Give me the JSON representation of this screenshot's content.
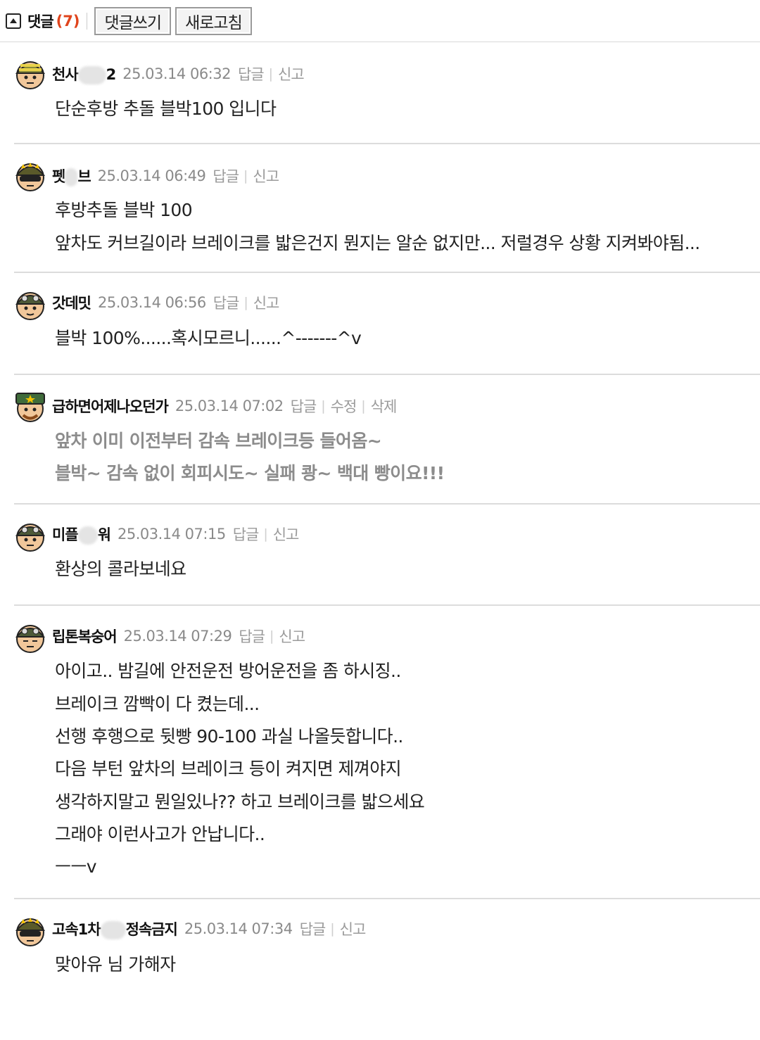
{
  "header": {
    "comment_label": "댓글",
    "comment_count": "(7)",
    "write_button": "댓글쓰기",
    "refresh_button": "새로고침"
  },
  "comments": [
    {
      "author_start": "천사",
      "author_end": "2",
      "date": "25.03.14 06:32",
      "actions": [
        "답글",
        "신고"
      ],
      "lines": [
        "단순후방 추돌 블박100 입니다"
      ]
    },
    {
      "author_start": "펫",
      "author_end": "브",
      "date": "25.03.14 06:49",
      "actions": [
        "답글",
        "신고"
      ],
      "lines": [
        "후방추돌 블박 100",
        "앞차도 커브길이라 브레이크를 밟은건지 뭔지는 알순 없지만... 저럴경우 상황 지켜봐야됨..."
      ]
    },
    {
      "author_start": "갓데밋",
      "author_end": "",
      "date": "25.03.14 06:56",
      "actions": [
        "답글",
        "신고"
      ],
      "lines": [
        "블박 100%......혹시모르니......^-------^v"
      ]
    },
    {
      "author_start": "급하면어제나오던가",
      "author_end": "",
      "date": "25.03.14 07:02",
      "actions": [
        "답글",
        "수정",
        "삭제"
      ],
      "lines": [
        "앞차 이미 이전부터 감속 브레이크등 들어옴~",
        "블박~ 감속 없이 회피시도~ 실패 쾅~ 백대 빵이요!!!"
      ]
    },
    {
      "author_start": "미플",
      "author_end": "워",
      "date": "25.03.14 07:15",
      "actions": [
        "답글",
        "신고"
      ],
      "lines": [
        "환상의 콜라보네요"
      ]
    },
    {
      "author_start": "립톤복숭어",
      "author_end": "",
      "date": "25.03.14 07:29",
      "actions": [
        "답글",
        "신고"
      ],
      "lines": [
        "아이고.. 밤길에 안전운전 방어운전을 좀 하시징..",
        "브레이크 깜빡이 다 켰는데...",
        "선행 후행으로 뒷빵 90-100 과실 나올듯합니다..",
        "다음 부턴 앞차의 브레이크 등이 켜지면 제껴야지",
        "생각하지말고 뭔일있나?? 하고 브레이크를 밟으세요",
        "그래야 이런사고가 안납니다..",
        "ㅡㅡv"
      ]
    },
    {
      "author_start": "고속1차",
      "author_end": "정속금지",
      "date": "25.03.14 07:34",
      "actions": [
        "답글",
        "신고"
      ],
      "lines": [
        "맞아유 님 가해자"
      ]
    }
  ],
  "colors": {
    "count": "#e0441c",
    "bold_body": "#8c8c8c",
    "meta": "#8a8a8a",
    "divider": "#dcdcdc"
  }
}
